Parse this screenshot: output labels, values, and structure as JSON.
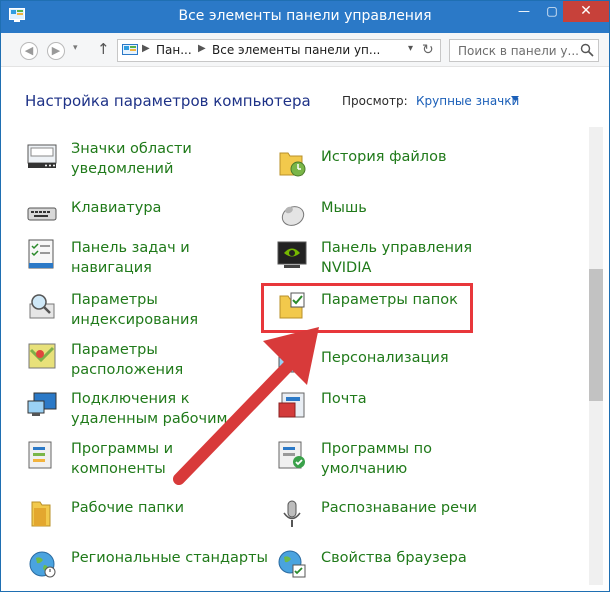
{
  "window": {
    "title": "Все элементы панели управления",
    "controls": {
      "minimize": "—",
      "maximize": "▢",
      "close": "✕"
    }
  },
  "nav": {
    "back_icon": "arrow-left-icon",
    "forward_icon": "arrow-right-icon",
    "up_icon": "arrow-up-icon",
    "address": {
      "segments": [
        "Пан...",
        "Все элементы панели уп..."
      ],
      "separator": "▶"
    },
    "refresh_icon": "refresh-icon",
    "search": {
      "placeholder": "Поиск в панели у..."
    }
  },
  "header": {
    "title": "Настройка параметров компьютера",
    "view_label": "Просмотр:",
    "view_value": "Крупные значки"
  },
  "items": [
    {
      "label": "Значки области\nуведомлений",
      "icon": "notification-area-icon"
    },
    {
      "label": "История файлов",
      "icon": "file-history-icon"
    },
    {
      "label": "Клавиатура",
      "icon": "keyboard-icon"
    },
    {
      "label": "Мышь",
      "icon": "mouse-icon"
    },
    {
      "label": "Панель задач и\nнавигация",
      "icon": "taskbar-icon"
    },
    {
      "label": "Панель управления\nNVIDIA",
      "icon": "nvidia-icon"
    },
    {
      "label": "Параметры\nиндексирования",
      "icon": "indexing-icon"
    },
    {
      "label": "Параметры папок",
      "icon": "folder-options-icon"
    },
    {
      "label": "Параметры\nрасположения",
      "icon": "location-icon"
    },
    {
      "label": "Персонализация",
      "icon": "personalization-icon"
    },
    {
      "label": "Подключения к\nудаленным рабочим",
      "icon": "remote-desktop-icon"
    },
    {
      "label": "Почта",
      "icon": "mail-icon"
    },
    {
      "label": "Программы и\nкомпоненты",
      "icon": "programs-icon"
    },
    {
      "label": "Программы по\nумолчанию",
      "icon": "default-programs-icon"
    },
    {
      "label": "Рабочие папки",
      "icon": "work-folders-icon"
    },
    {
      "label": "Распознавание речи",
      "icon": "speech-recognition-icon"
    },
    {
      "label": "Региональные стандарты",
      "icon": "region-icon"
    },
    {
      "label": "Свойства браузера",
      "icon": "internet-options-icon"
    }
  ],
  "colors": {
    "titlebar": "#2b79c7",
    "link_green": "#207a1a",
    "title_blue": "#1e3287",
    "annotation_red": "#e8373b"
  }
}
